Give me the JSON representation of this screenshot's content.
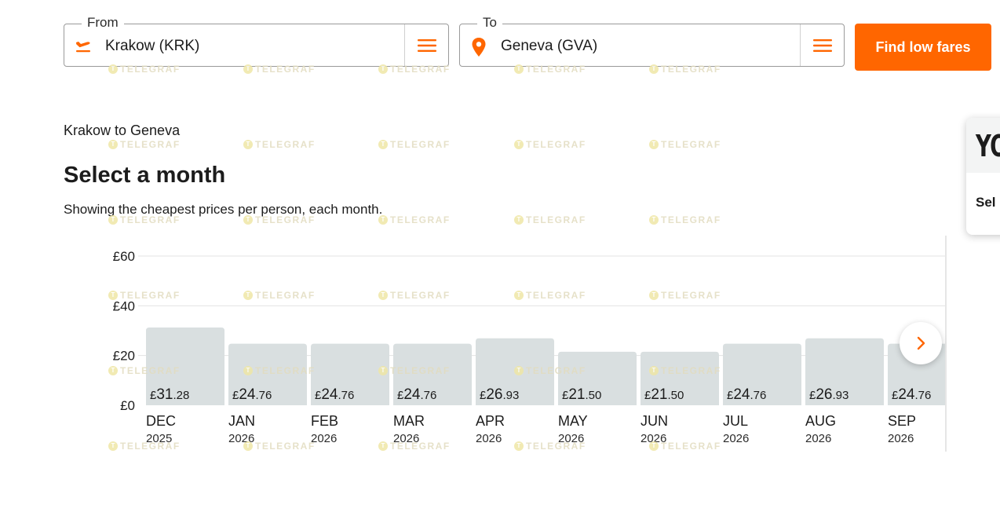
{
  "search": {
    "from": {
      "legend": "From",
      "value": "Krakow (KRK)",
      "icon": "plane-takeoff-icon"
    },
    "to": {
      "legend": "To",
      "value": "Geneva (GVA)",
      "icon": "location-pin-icon"
    },
    "menu_icon": "hamburger-menu-icon",
    "find_button": "Find low fares"
  },
  "main": {
    "route": "Krakow to Geneva",
    "heading": "Select a month",
    "subtitle": "Showing the cheapest prices per person, each month."
  },
  "side_card": {
    "title": "YO",
    "text": "Sel"
  },
  "watermark": {
    "text": "TELEGRAF",
    "glyph": "T"
  },
  "colors": {
    "accent": "#ff6600",
    "bar": "#d9dfe0"
  },
  "chart_data": {
    "type": "bar",
    "currency": "£",
    "yticks": [
      "£0",
      "£20",
      "£40",
      "£60"
    ],
    "ytick_values": [
      0,
      20,
      40,
      60
    ],
    "ylim": [
      0,
      60
    ],
    "months": [
      {
        "month": "DEC",
        "year": "2025",
        "big": "31",
        "small": ".28",
        "value": 31.28
      },
      {
        "month": "JAN",
        "year": "2026",
        "big": "24",
        "small": ".76",
        "value": 24.76
      },
      {
        "month": "FEB",
        "year": "2026",
        "big": "24",
        "small": ".76",
        "value": 24.76
      },
      {
        "month": "MAR",
        "year": "2026",
        "big": "24",
        "small": ".76",
        "value": 24.76
      },
      {
        "month": "APR",
        "year": "2026",
        "big": "26",
        "small": ".93",
        "value": 26.93
      },
      {
        "month": "MAY",
        "year": "2026",
        "big": "21",
        "small": ".50",
        "value": 21.5
      },
      {
        "month": "JUN",
        "year": "2026",
        "big": "21",
        "small": ".50",
        "value": 21.5
      },
      {
        "month": "JUL",
        "year": "2026",
        "big": "24",
        "small": ".76",
        "value": 24.76
      },
      {
        "month": "AUG",
        "year": "2026",
        "big": "26",
        "small": ".93",
        "value": 26.93
      },
      {
        "month": "SEP",
        "year": "2026",
        "big": "24",
        "small": ".76",
        "value": 24.76
      }
    ]
  }
}
